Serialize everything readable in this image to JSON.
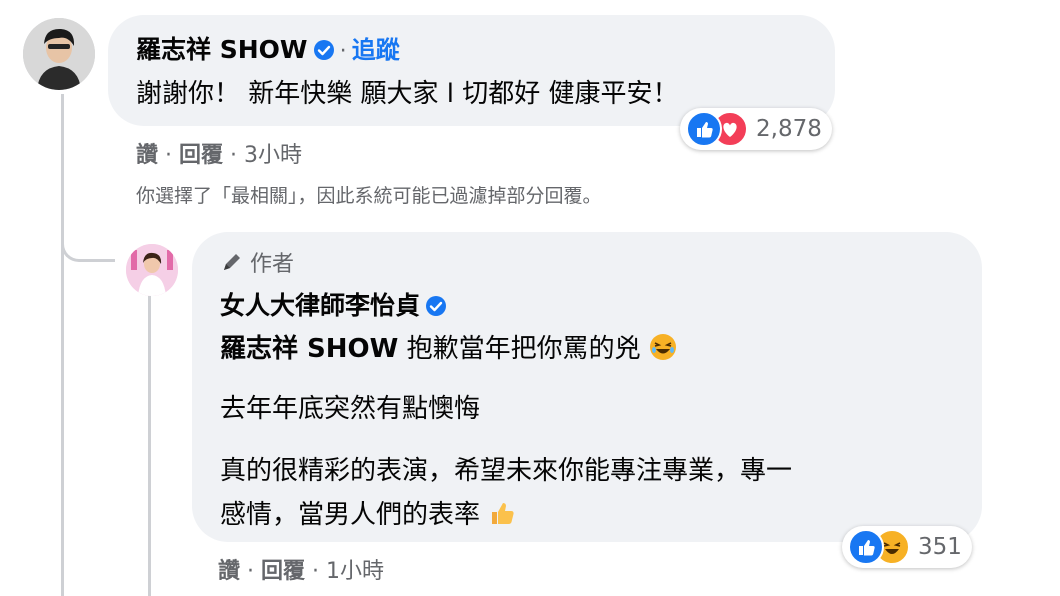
{
  "comment": {
    "author": "羅志祥 SHOW",
    "follow_dot": "·",
    "follow_label": "追蹤",
    "text": "謝謝你！ 新年快樂 願大家 l 切都好 健康平安！",
    "reaction_count": "2,878",
    "actions": {
      "like": "讚",
      "sep1": "·",
      "reply": "回覆",
      "sep2": "·",
      "time": "3小時"
    },
    "filter_notice": "你選擇了「最相關」，因此系統可能已過濾掉部分回覆。"
  },
  "reply": {
    "badge": "作者",
    "author": "女人大律師李怡貞",
    "mention": "羅志祥 SHOW",
    "line1": "抱歉當年把你罵的兇",
    "line2": "去年年底突然有點懊悔",
    "line3": "真的很精彩的表演，希望未來你能專注專業，專一",
    "line4": "感情，當男人們的表率",
    "reaction_count": "351",
    "actions": {
      "like": "讚",
      "sep1": "·",
      "reply": "回覆",
      "sep2": "·",
      "time": "1小時"
    }
  },
  "icons": {
    "verified": "verified-badge-icon",
    "pencil": "pencil-icon",
    "like": "like-reaction-icon",
    "love": "love-reaction-icon",
    "haha": "haha-reaction-icon",
    "thumbs_up_emoji": "thumbs-up-emoji-icon"
  },
  "colors": {
    "accent": "#1877f2",
    "bubble": "#f0f2f5",
    "meta": "#65676b",
    "love": "#f33e58",
    "haha": "#f7b125"
  }
}
